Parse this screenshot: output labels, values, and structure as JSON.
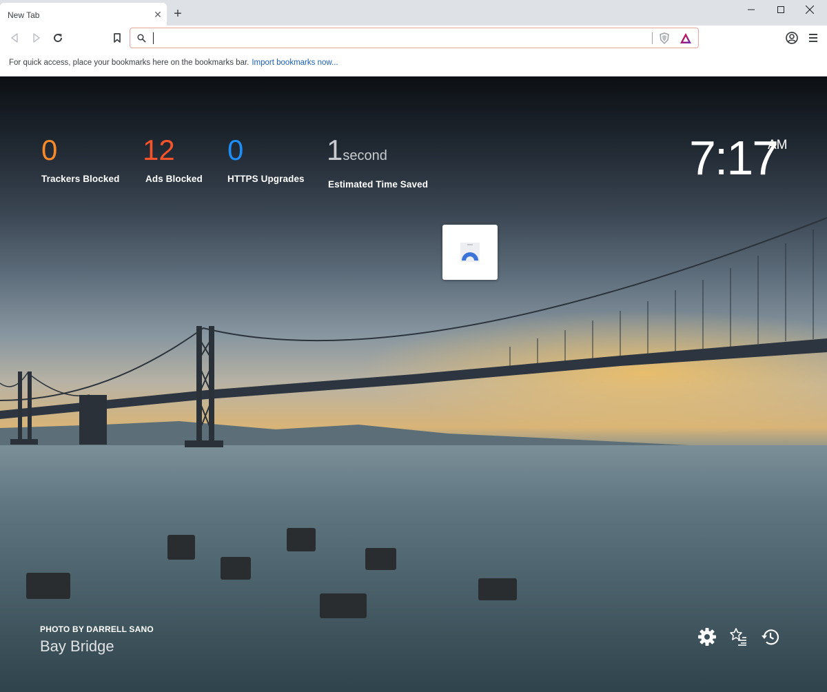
{
  "tab": {
    "title": "New Tab"
  },
  "omnibox": {
    "value": "",
    "placeholder": ""
  },
  "bookmarks_bar": {
    "message": "For quick access, place your bookmarks here on the bookmarks bar.",
    "link": "Import bookmarks now..."
  },
  "stats": [
    {
      "value": "0",
      "label": "Trackers Blocked",
      "color": "#f58a2b"
    },
    {
      "value": "12",
      "label": "Ads Blocked",
      "color": "#f5542b"
    },
    {
      "value": "0",
      "label": "HTTPS Upgrades",
      "color": "#1e8df5"
    }
  ],
  "time_saved": {
    "value": "1",
    "unit": "second",
    "label": "Estimated Time Saved"
  },
  "clock": {
    "time": "7:17",
    "ampm": "AM"
  },
  "photo": {
    "credit_prefix": "PHOTO BY",
    "photographer": "DARRELL SANO",
    "title": "Bay Bridge"
  },
  "icons": [
    "back-icon",
    "forward-icon",
    "reload-icon",
    "bookmark-icon",
    "search-icon",
    "brave-shields-icon",
    "brave-rewards-icon",
    "profile-icon",
    "menu-icon",
    "settings-icon",
    "bookmarks-icon",
    "history-icon"
  ]
}
